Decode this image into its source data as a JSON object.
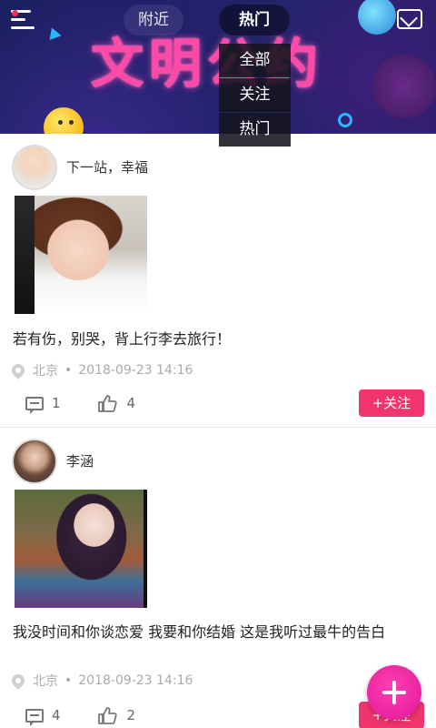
{
  "banner": {
    "title": "文明公约"
  },
  "header": {
    "tabs": [
      {
        "label": "附近"
      },
      {
        "label": "热门"
      }
    ]
  },
  "dropdown": {
    "options": [
      "全部",
      "关注",
      "热门"
    ]
  },
  "posts": [
    {
      "username": "下一站，幸福",
      "text": "若有伤，别哭，背上行李去旅行！",
      "location": "北京",
      "separator": "•",
      "timestamp": "2018-09-23 14:16",
      "comments": "1",
      "likes": "4",
      "follow_label": "+关注"
    },
    {
      "username": "李涵",
      "text": "我没时间和你谈恋爱 我要和你结婚 这是我听过最牛的告白",
      "location": "北京",
      "separator": "•",
      "timestamp": "2018-09-23 14:16",
      "comments": "4",
      "likes": "2",
      "follow_label": "+关注"
    }
  ],
  "colors": {
    "accent": "#f0346c",
    "fab": "#e0179a",
    "banner_title": "#ff49a8"
  },
  "icons": [
    "menu-icon",
    "mail-icon",
    "location-pin-icon",
    "comment-icon",
    "thumbs-up-icon",
    "plus-icon"
  ]
}
